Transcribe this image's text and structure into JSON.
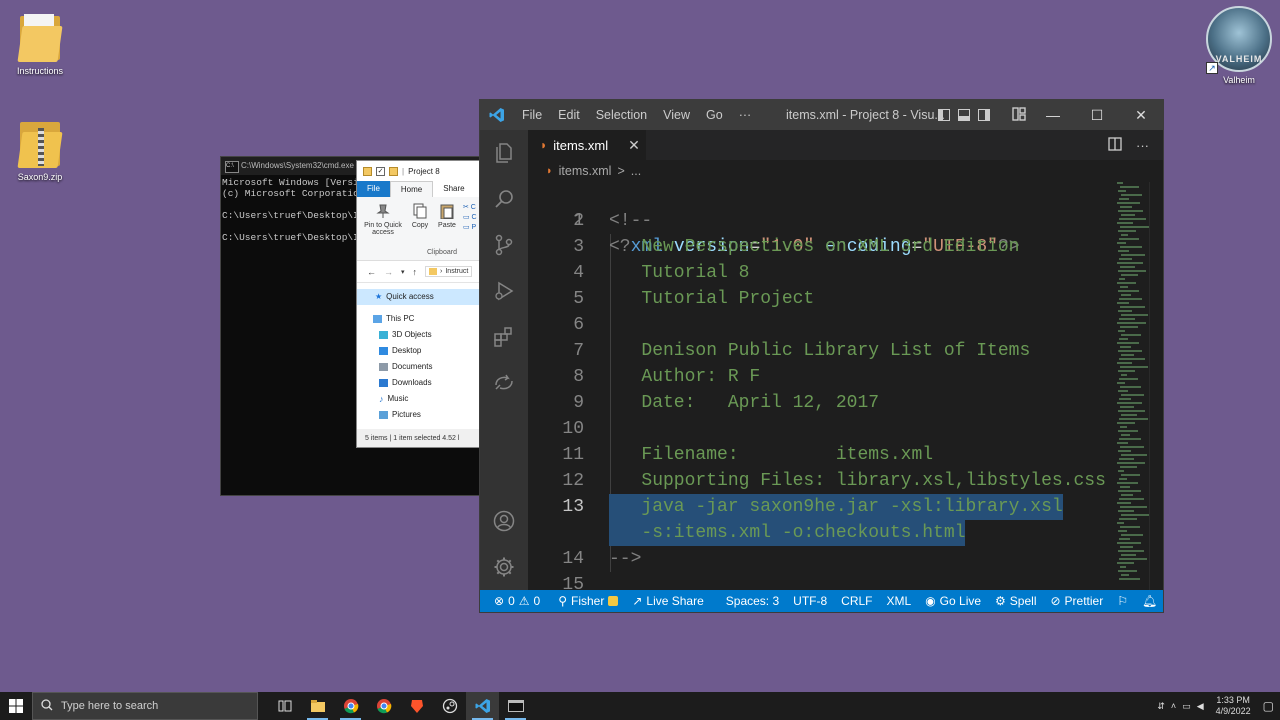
{
  "desktop": {
    "icons": [
      {
        "label": "Instructions"
      },
      {
        "label": "Saxon9.zip"
      },
      {
        "label": "Valheim"
      }
    ],
    "valheim_logo_text": "VALHEIM"
  },
  "cmd": {
    "title": "C:\\Windows\\System32\\cmd.exe",
    "lines": [
      "Microsoft Windows [Version",
      "(c) Microsoft Corporation",
      "",
      "C:\\Users\\truef\\Desktop\\Ins",
      "",
      "C:\\Users\\truef\\Desktop\\Ins"
    ]
  },
  "explorer": {
    "title": "Project 8",
    "tabs": [
      "File",
      "Home",
      "Share"
    ],
    "ribbon": {
      "pin": "Pin to Quick access",
      "copy": "Copy",
      "paste": "Paste",
      "group": "Clipboard"
    },
    "path_text": "Instruct",
    "sidebar": {
      "quick_access": "Quick access",
      "this_pc": "This PC",
      "items": [
        "3D Objects",
        "Desktop",
        "Documents",
        "Downloads",
        "Music",
        "Pictures"
      ]
    },
    "status": "5 items  |  1 item selected  4.52 l"
  },
  "vscode": {
    "menu": [
      "File",
      "Edit",
      "Selection",
      "View",
      "Go",
      "···"
    ],
    "window_title": "items.xml - Project 8 - Visu...",
    "window_buttons": {
      "minimize": "—",
      "maximize": "☐",
      "close": "✕"
    },
    "tab": {
      "label": "items.xml",
      "close": "✕"
    },
    "breadcrumb": {
      "file": "items.xml",
      "sep": ">",
      "more": "..."
    },
    "lines": [
      {
        "n": "1",
        "text": "<?xml version=\"1.0\" encoding=\"UTF-8\"?>"
      },
      {
        "n": "2",
        "text": "<!--"
      },
      {
        "n": "3",
        "text": "   New Perspectives on XML 3rd Edition"
      },
      {
        "n": "4",
        "text": "   Tutorial 8"
      },
      {
        "n": "5",
        "text": "   Tutorial Project"
      },
      {
        "n": "6",
        "text": ""
      },
      {
        "n": "7",
        "text": "   Denison Public Library List of Items"
      },
      {
        "n": "8",
        "text": "   Author: R F"
      },
      {
        "n": "9",
        "text": "   Date:   April 12, 2017"
      },
      {
        "n": "10",
        "text": ""
      },
      {
        "n": "11",
        "text": "   Filename:         items.xml"
      },
      {
        "n": "12",
        "text": "   Supporting Files: library.xsl,libstyles.css"
      },
      {
        "n": "13",
        "text": "   java -jar saxon9he.jar -xsl:library.xsl"
      },
      {
        "n": "",
        "text": "   -s:items.xml -o:checkouts.html"
      },
      {
        "n": "14",
        "text": "-->"
      },
      {
        "n": "15",
        "text": ""
      }
    ],
    "xml_decl": {
      "open": "<?",
      "tag": "xml",
      "attr1": "version",
      "val1": "\"1.0\"",
      "attr2": "encoding",
      "val2": "\"UTF-8\"",
      "close": "?>"
    },
    "status": {
      "errors": "0",
      "warnings": "0",
      "account": "Fisher",
      "live_share": "Live Share",
      "spaces": "Spaces: 3",
      "encoding": "UTF-8",
      "eol": "CRLF",
      "language": "XML",
      "go_live": "Go Live",
      "spell": "Spell",
      "prettier": "Prettier"
    }
  },
  "taskbar": {
    "search_placeholder": "Type here to search",
    "time": "1:33 PM",
    "date": "4/9/2022"
  },
  "colors": {
    "desktop_bg": "#6e5a8e",
    "statusbar": "#007acc",
    "comment": "#6a9955",
    "selection": "#264f78"
  }
}
